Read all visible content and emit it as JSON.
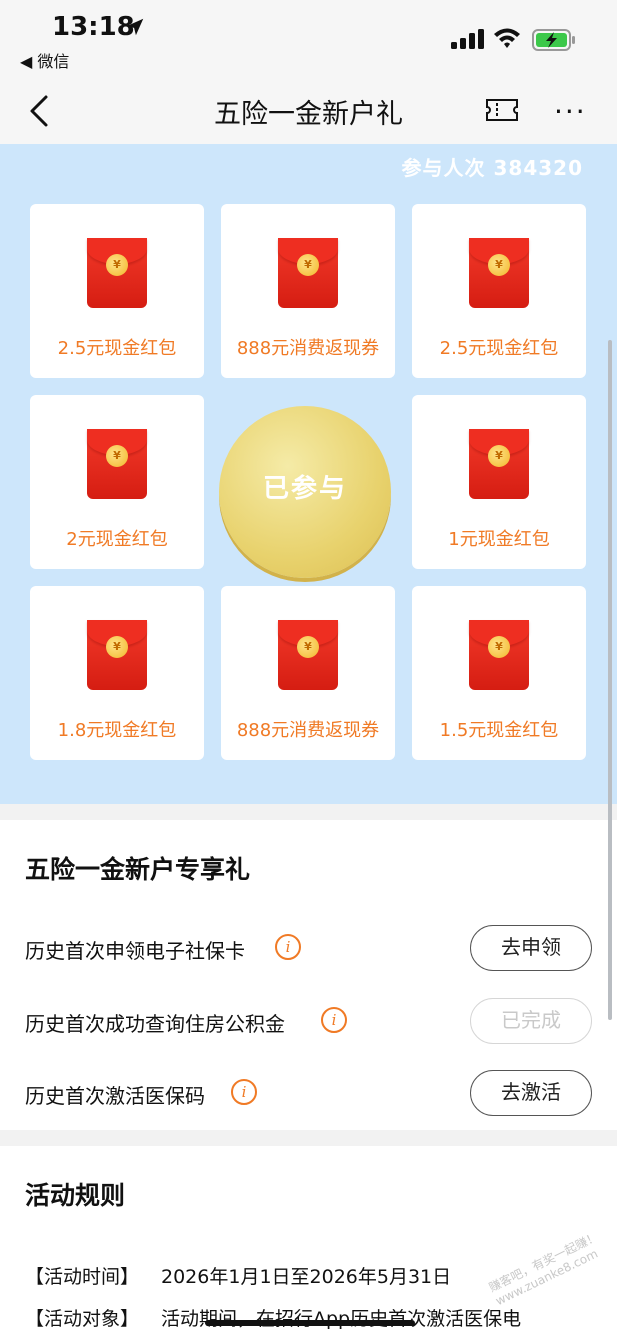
{
  "status_bar": {
    "time": "13:18",
    "back_app": "◀ 微信"
  },
  "nav": {
    "title": "五险一金新户礼",
    "more": "···"
  },
  "lottery": {
    "participants": "参与人次 384320",
    "center_button": "已参与",
    "coin_symbol": "¥",
    "prizes": [
      "2.5元现金红包",
      "888元消费返现券",
      "2.5元现金红包",
      "2元现金红包",
      "1元现金红包",
      "1.8元现金红包",
      "888元消费返现券",
      "1.5元现金红包"
    ]
  },
  "tasks": {
    "title": "五险一金新户专享礼",
    "items": [
      {
        "label": "历史首次申领电子社保卡",
        "button": "去申领",
        "completed": false
      },
      {
        "label": "历史首次成功查询住房公积金",
        "button": "已完成",
        "completed": true
      },
      {
        "label": "历史首次激活医保码",
        "button": "去激活",
        "completed": false
      }
    ]
  },
  "rules": {
    "title": "活动规则",
    "rows": [
      {
        "key": "【活动时间】",
        "value": "2026年1月1日至2026年5月31日"
      },
      {
        "key": "【活动对象】",
        "value": "活动期间，在招行App历史首次激活医保电"
      }
    ]
  },
  "watermark": "赚客吧，有奖一起赚！ www.zuanke8.com",
  "colors": {
    "lottery_bg": "#cde6fb",
    "accent_orange": "#f07a25",
    "envelope_red": "#e02a1d",
    "coin_gold": "#e8d26d"
  }
}
